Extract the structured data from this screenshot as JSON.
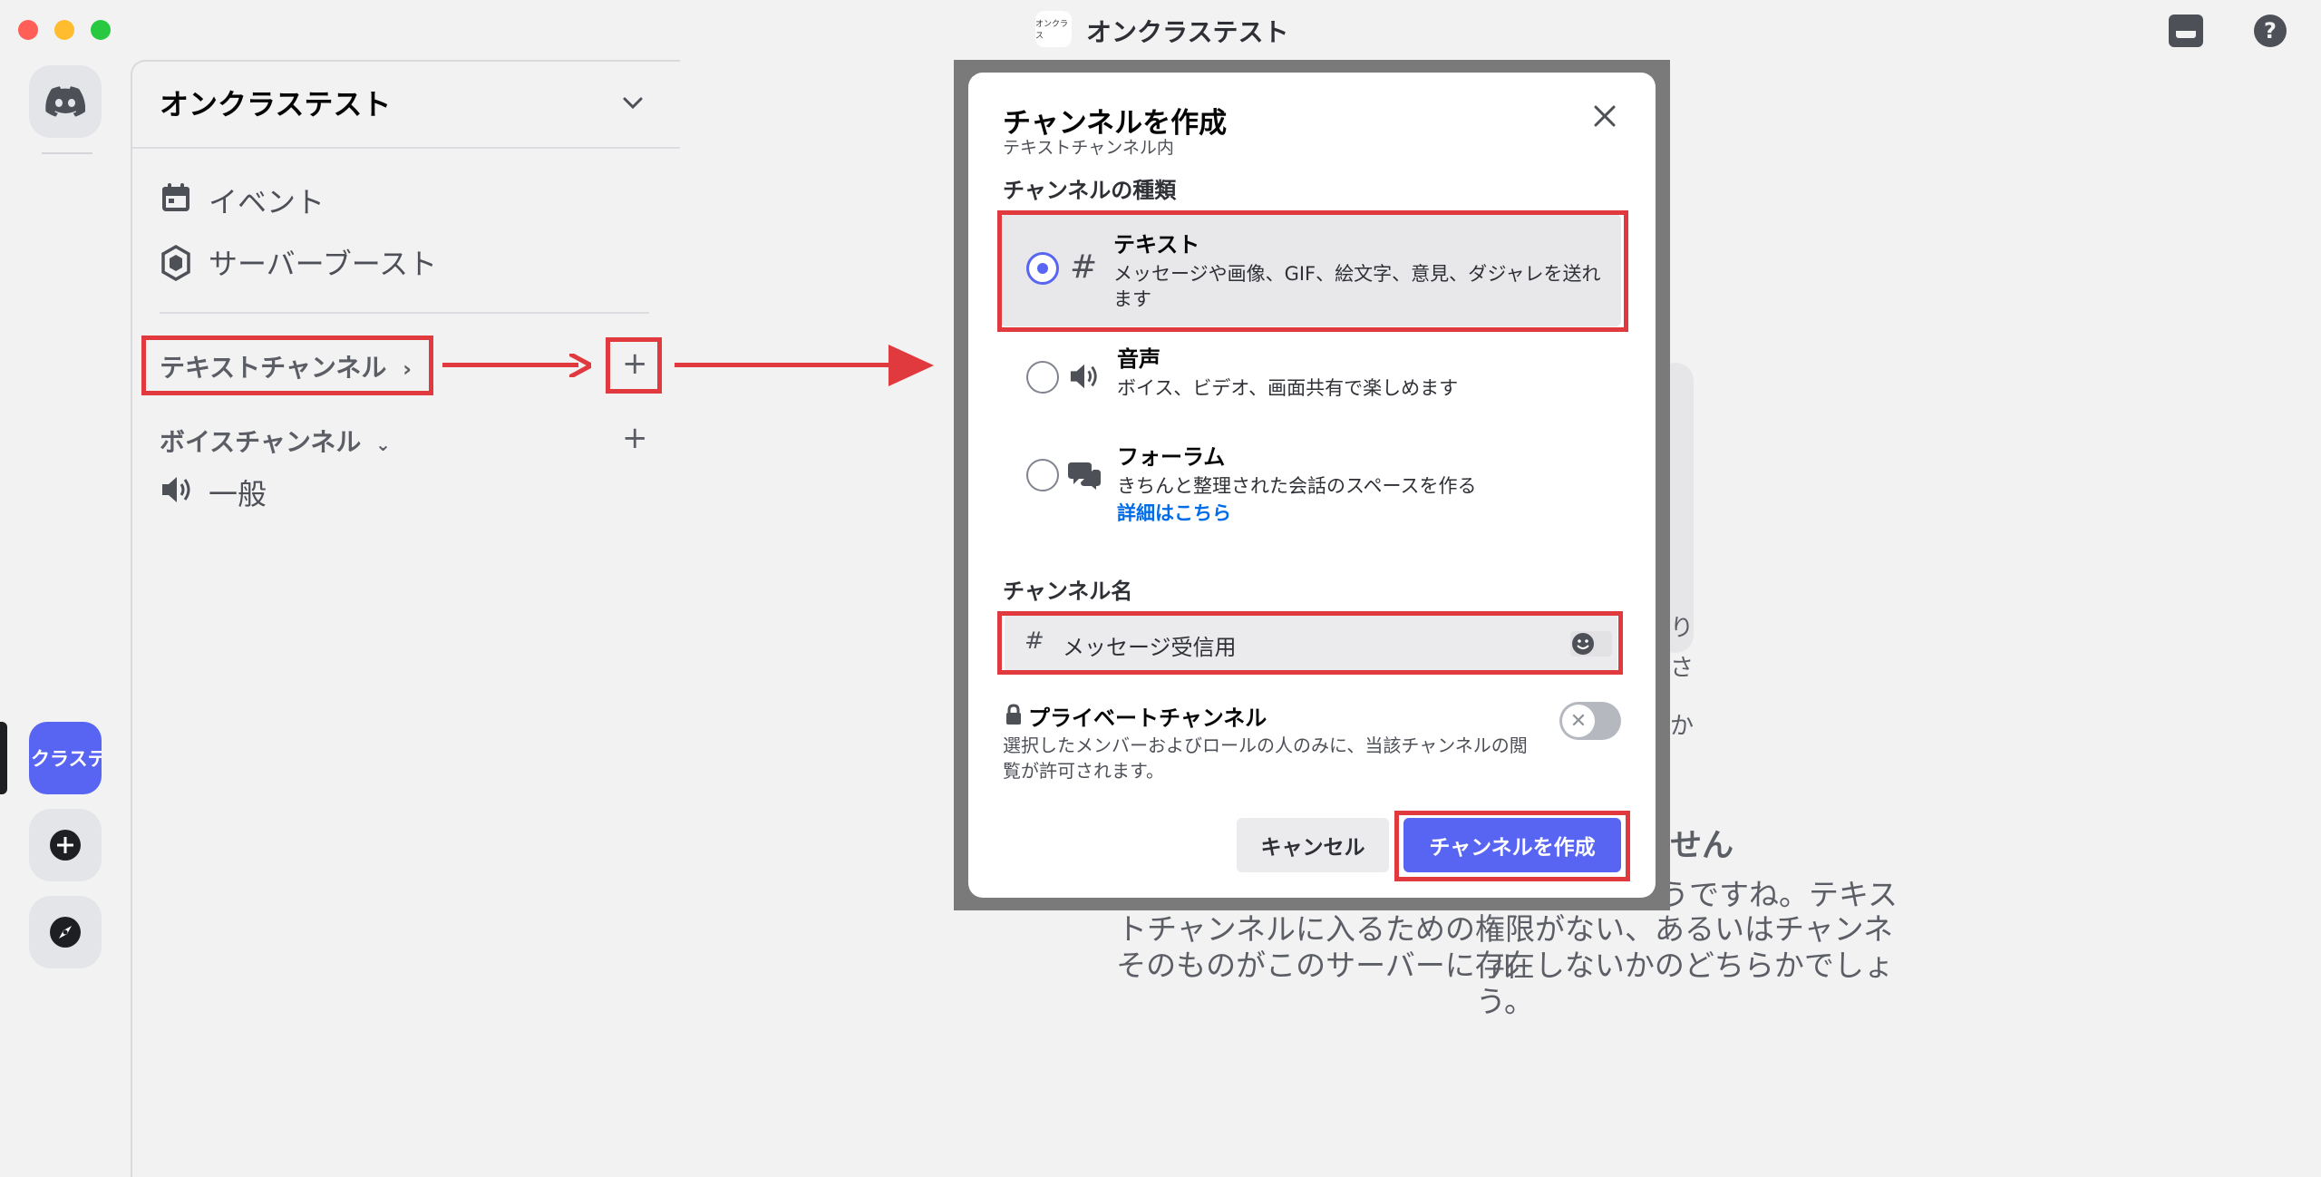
{
  "window": {
    "title": "オンクラステスト",
    "server_mini_label": "オンクラス"
  },
  "rail": {
    "active_server_label": "クラステ",
    "add_server_icon": "plus-circle-icon",
    "explore_icon": "compass-icon",
    "home_icon": "discord-logo-icon"
  },
  "sidebar": {
    "server_name": "オンクラステスト",
    "items": [
      {
        "label": "イベント",
        "icon": "calendar-icon"
      },
      {
        "label": "サーバーブースト",
        "icon": "boost-icon"
      }
    ],
    "categories": [
      {
        "label": "テキストチャンネル",
        "chevron": "›"
      },
      {
        "label": "ボイスチャンネル",
        "chevron": "⌄"
      }
    ],
    "voice_channels": [
      {
        "label": "一般",
        "icon": "speaker-icon"
      }
    ],
    "add_symbol": "+"
  },
  "background": {
    "heading_fragment": "せん",
    "body_lines": [
      "うですね。テキス",
      "トチャンネルに入るための権限がない、あるいはチャンネル",
      "そのものがこのサーバーに存在しないかのどちらかでしょ",
      "う。"
    ],
    "edge_fragments": [
      "り",
      "さ",
      "か"
    ]
  },
  "modal": {
    "title": "チャンネルを作成",
    "subtitle": "テキストチャンネル内",
    "type_label": "チャンネルの種類",
    "options": [
      {
        "title": "テキスト",
        "description": "メッセージや画像、GIF、絵文字、意見、ダジャレを送れます",
        "icon_glyph": "#",
        "selected": true
      },
      {
        "title": "音声",
        "description": "ボイス、ビデオ、画面共有で楽しめます",
        "icon": "speaker-icon",
        "selected": false
      },
      {
        "title": "フォーラム",
        "description": "きちんと整理された会話のスペースを作る",
        "link": "詳細はこちら",
        "icon": "forum-icon",
        "selected": false
      }
    ],
    "name_label": "チャンネル名",
    "name_prefix": "#",
    "name_value": "メッセージ受信用",
    "private": {
      "title": "プライベートチャンネル",
      "description": "選択したメンバーおよびロールの人のみに、当該チャンネルの閲覧が許可されます。",
      "enabled": false
    },
    "cancel_label": "キャンセル",
    "create_label": "チャンネルを作成"
  },
  "colors": {
    "accent": "#5865f2",
    "annotation_red": "#e0393e",
    "link": "#006ce7"
  }
}
